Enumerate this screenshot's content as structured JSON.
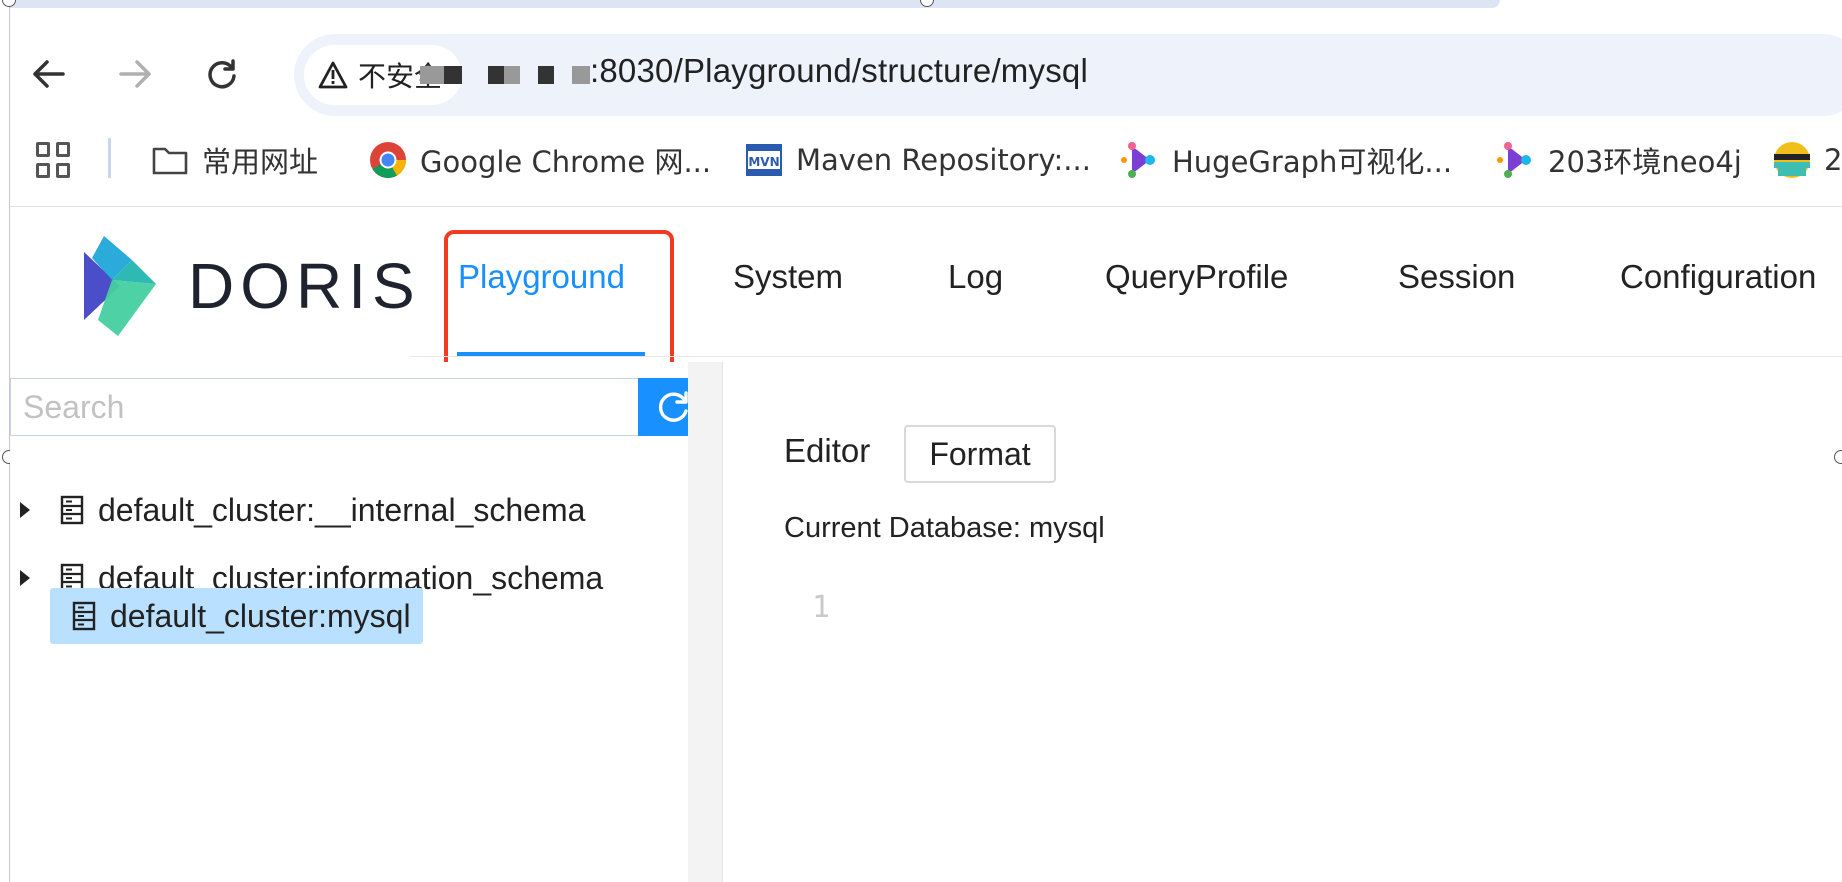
{
  "browser": {
    "back_icon": "←",
    "forward_icon": "→",
    "reload_icon": "↻",
    "security_label": "不安全",
    "url_visible": ":8030/Playground/structure/mysql"
  },
  "bookmarks": [
    {
      "label": "常用网址",
      "icon": "folder-icon"
    },
    {
      "label": "Google Chrome 网...",
      "icon": "chrome-icon"
    },
    {
      "label": "Maven Repository:...",
      "icon": "maven-icon"
    },
    {
      "label": "HugeGraph可视化...",
      "icon": "hugegraph-icon"
    },
    {
      "label": "203环境neo4j",
      "icon": "hugegraph-icon"
    },
    {
      "label": "2",
      "icon": "elastic-icon"
    }
  ],
  "app": {
    "logo_text": "DORIS",
    "menu": [
      {
        "label": "Playground",
        "active": true
      },
      {
        "label": "System"
      },
      {
        "label": "Log"
      },
      {
        "label": "QueryProfile"
      },
      {
        "label": "Session"
      },
      {
        "label": "Configuration"
      }
    ]
  },
  "sidebar": {
    "search_placeholder": "Search",
    "tree": [
      {
        "label": "default_cluster:__internal_schema",
        "expandable": true
      },
      {
        "label": "default_cluster:information_schema",
        "expandable": true
      },
      {
        "label": "default_cluster:mysql",
        "expandable": false,
        "selected": true
      }
    ]
  },
  "editor": {
    "label": "Editor",
    "format_label": "Format",
    "current_database": "Current Database: mysql",
    "line_number": "1"
  },
  "colors": {
    "accent": "#1890ff",
    "highlight_box": "#f23a22",
    "selected_row": "#bae0ff",
    "omnibox": "#eef2fb"
  }
}
